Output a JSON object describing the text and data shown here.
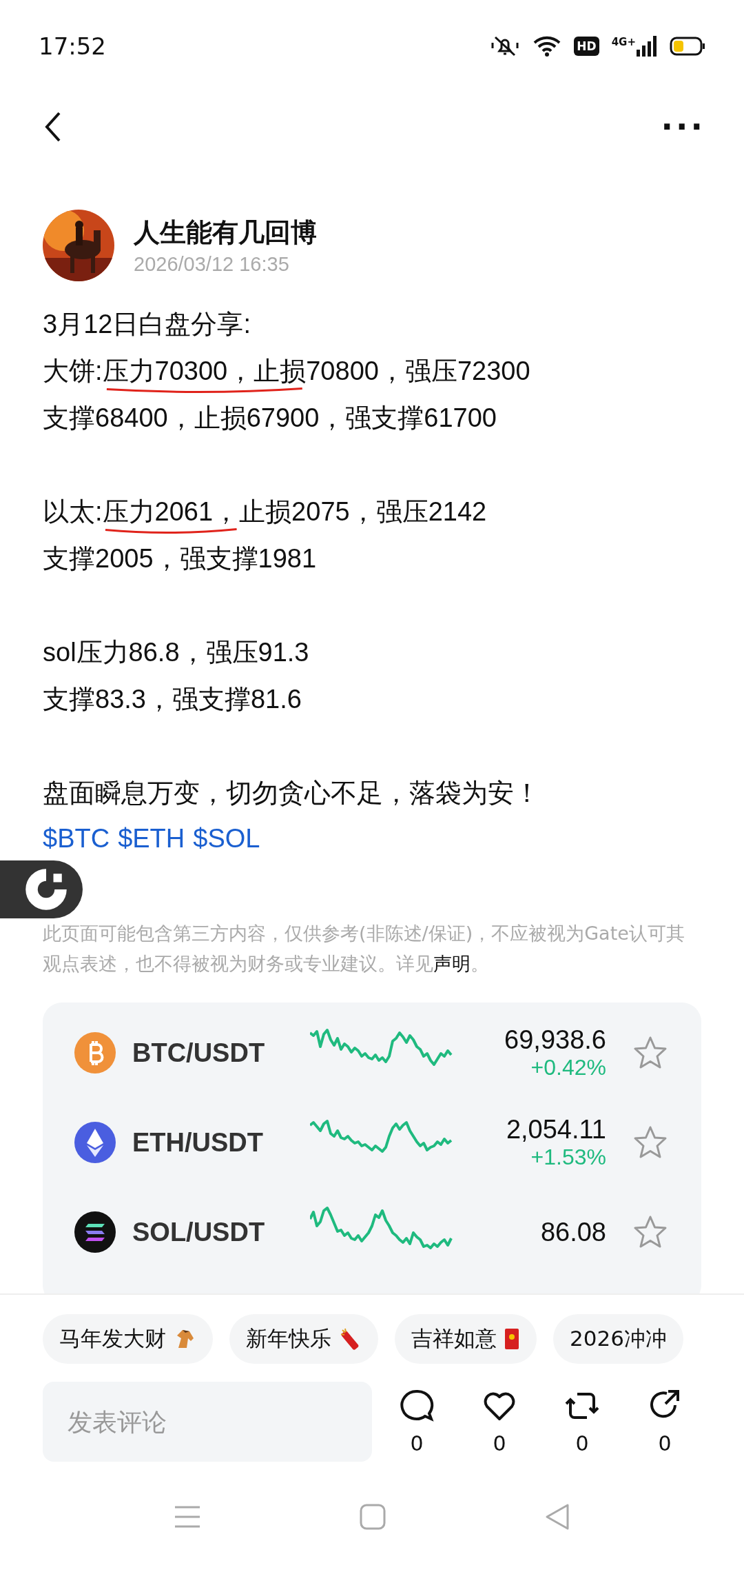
{
  "status_bar": {
    "time": "17:52",
    "hd_badge": "HD",
    "network": "4G+"
  },
  "nav": {
    "more": "···"
  },
  "post": {
    "author": "人生能有几回博",
    "date": "2026/03/12 16:35",
    "paragraphs": [
      [
        [
          {
            "text": "3月12日白盘分享:",
            "marked": false
          }
        ],
        [
          {
            "text": "大饼:",
            "marked": false
          },
          {
            "text": "压力70300，止损",
            "marked": true
          },
          {
            "text": "70800，强压72300",
            "marked": false
          }
        ],
        [
          {
            "text": "支撑68400，止损67900，强支撑61700",
            "marked": false
          }
        ]
      ],
      [
        [
          {
            "text": "以太:",
            "marked": false
          },
          {
            "text": "压力2061，",
            "marked": true
          },
          {
            "text": "止损2075，强压2142",
            "marked": false
          }
        ],
        [
          {
            "text": "支撑2005，强支撑1981",
            "marked": false
          }
        ]
      ],
      [
        [
          {
            "text": "sol压力86.8，强压91.3",
            "marked": false
          }
        ],
        [
          {
            "text": "支撑83.3，强支撑81.6",
            "marked": false
          }
        ]
      ],
      [
        [
          {
            "text": "盘面瞬息万变，切勿贪心不足，落袋为安！",
            "marked": false
          }
        ]
      ]
    ],
    "tags": [
      "$BTC",
      "$ETH",
      "$SOL"
    ],
    "disclaimer": "此页面可能包含第三方内容，仅供参考(非陈述/保证)，不应被视为Gate认可其观点表述，也不得被视为财务或专业建议。详见",
    "disclaimer_link": "声明",
    "disclaimer_end": "。"
  },
  "markets": [
    {
      "kind": "btc",
      "pair": "BTC/USDT",
      "price": "69,938.6",
      "change": "+0.42%",
      "favorite": false
    },
    {
      "kind": "eth",
      "pair": "ETH/USDT",
      "price": "2,054.11",
      "change": "+1.53%",
      "favorite": false
    },
    {
      "kind": "sol",
      "pair": "SOL/USDT",
      "price": "86.08",
      "favorite": false
    }
  ],
  "topics": [
    "马年发大财",
    "新年快乐",
    "吉祥如意",
    "2026冲冲"
  ],
  "comment": {
    "placeholder": "发表评论"
  },
  "actions": [
    {
      "kind": "comment",
      "count": "0"
    },
    {
      "kind": "like",
      "count": "0"
    },
    {
      "kind": "repost",
      "count": "0"
    },
    {
      "kind": "share",
      "count": "0"
    }
  ]
}
